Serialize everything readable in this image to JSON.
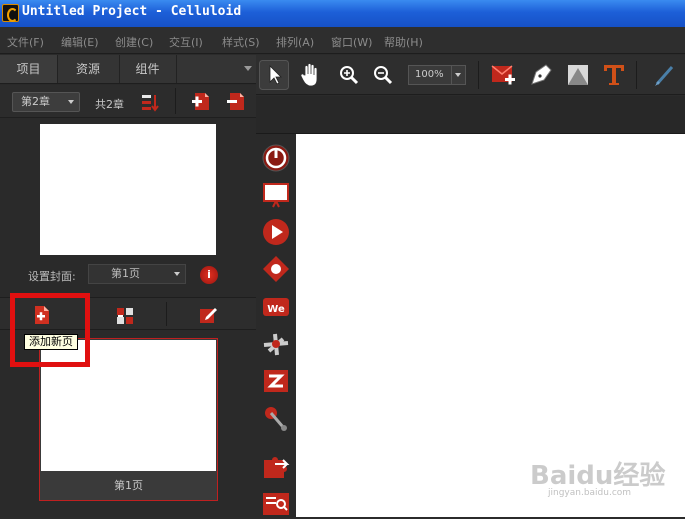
{
  "window": {
    "title": "Untitled Project - Celluloid"
  },
  "menu": [
    {
      "label": "文件(F)"
    },
    {
      "label": "编辑(E)"
    },
    {
      "label": "创建(C)"
    },
    {
      "label": "交互(I)"
    },
    {
      "label": "样式(S)"
    },
    {
      "label": "排列(A)"
    },
    {
      "label": "窗口(W)"
    },
    {
      "label": "帮助(H)"
    }
  ],
  "left_panel": {
    "tabs": [
      {
        "label": "项目"
      },
      {
        "label": "资源"
      },
      {
        "label": "组件"
      }
    ],
    "chapter_select": "第2章",
    "chapter_total": "共2章",
    "cover_label": "设置封面:",
    "cover_select": "第1页",
    "info_icon": "i",
    "tooltip": "添加新页",
    "page_thumb_label": "第1页"
  },
  "toolbar": {
    "zoom": "100%"
  },
  "watermark": {
    "text": "Baidu经验",
    "sub": "jingyan.baidu.com"
  },
  "colors": {
    "accent_red": "#c0281c",
    "titlebar_blue": "#1d5fd8",
    "highlight": "#e01010"
  }
}
